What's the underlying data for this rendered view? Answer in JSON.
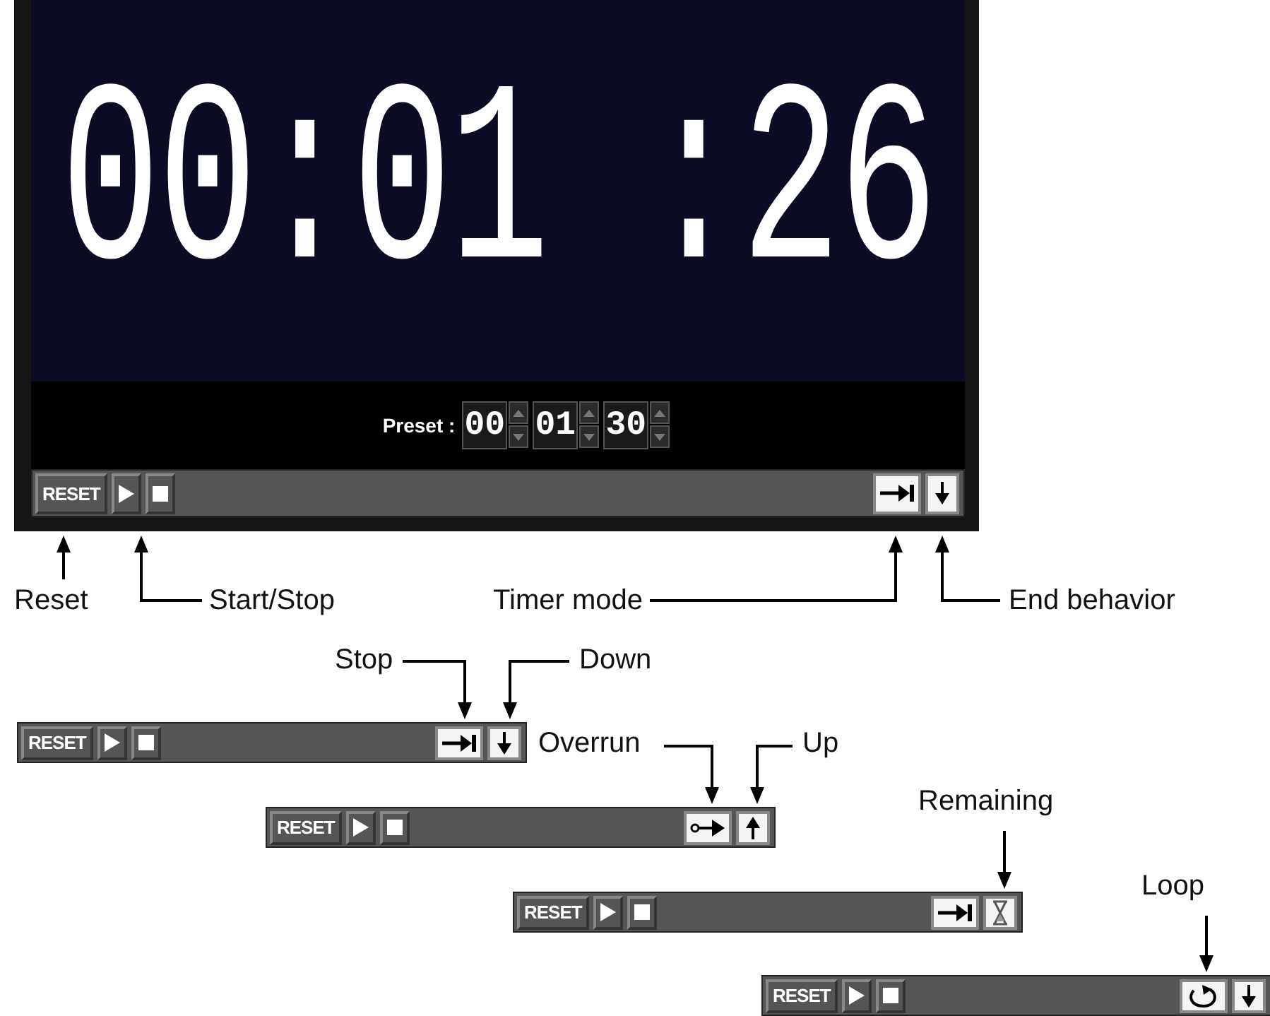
{
  "timer_window": {
    "display": "00:01 :26",
    "preset": {
      "label": "Preset :",
      "fields": [
        {
          "value": "00"
        },
        {
          "value": "01"
        },
        {
          "value": "30"
        }
      ]
    },
    "toolbar": {
      "reset": "RESET",
      "mode_button": {
        "kind": "stop"
      },
      "end_button": {
        "kind": "down"
      }
    }
  },
  "main_callouts": [
    {
      "text": "Reset"
    },
    {
      "text": "Start/Stop"
    },
    {
      "text": "Timer mode"
    },
    {
      "text": "End behavior"
    }
  ],
  "variants": [
    {
      "toolbar": {
        "reset": "RESET",
        "mode_button": {
          "kind": "stop"
        },
        "end_button": {
          "kind": "down"
        }
      },
      "callouts": [
        {
          "text": "Stop"
        },
        {
          "text": "Down"
        }
      ]
    },
    {
      "toolbar": {
        "reset": "RESET",
        "mode_button": {
          "kind": "overrun"
        },
        "end_button": {
          "kind": "up"
        }
      },
      "callouts": [
        {
          "text": "Overrun"
        },
        {
          "text": "Up"
        }
      ]
    },
    {
      "toolbar": {
        "reset": "RESET",
        "mode_button": {
          "kind": "stop"
        },
        "end_button": {
          "kind": "remaining"
        }
      },
      "callouts": [
        {
          "text": "Remaining"
        }
      ]
    },
    {
      "toolbar": {
        "reset": "RESET",
        "mode_button": {
          "kind": "loop"
        },
        "end_button": {
          "kind": "down"
        }
      },
      "callouts": [
        {
          "text": "Loop"
        }
      ]
    }
  ]
}
